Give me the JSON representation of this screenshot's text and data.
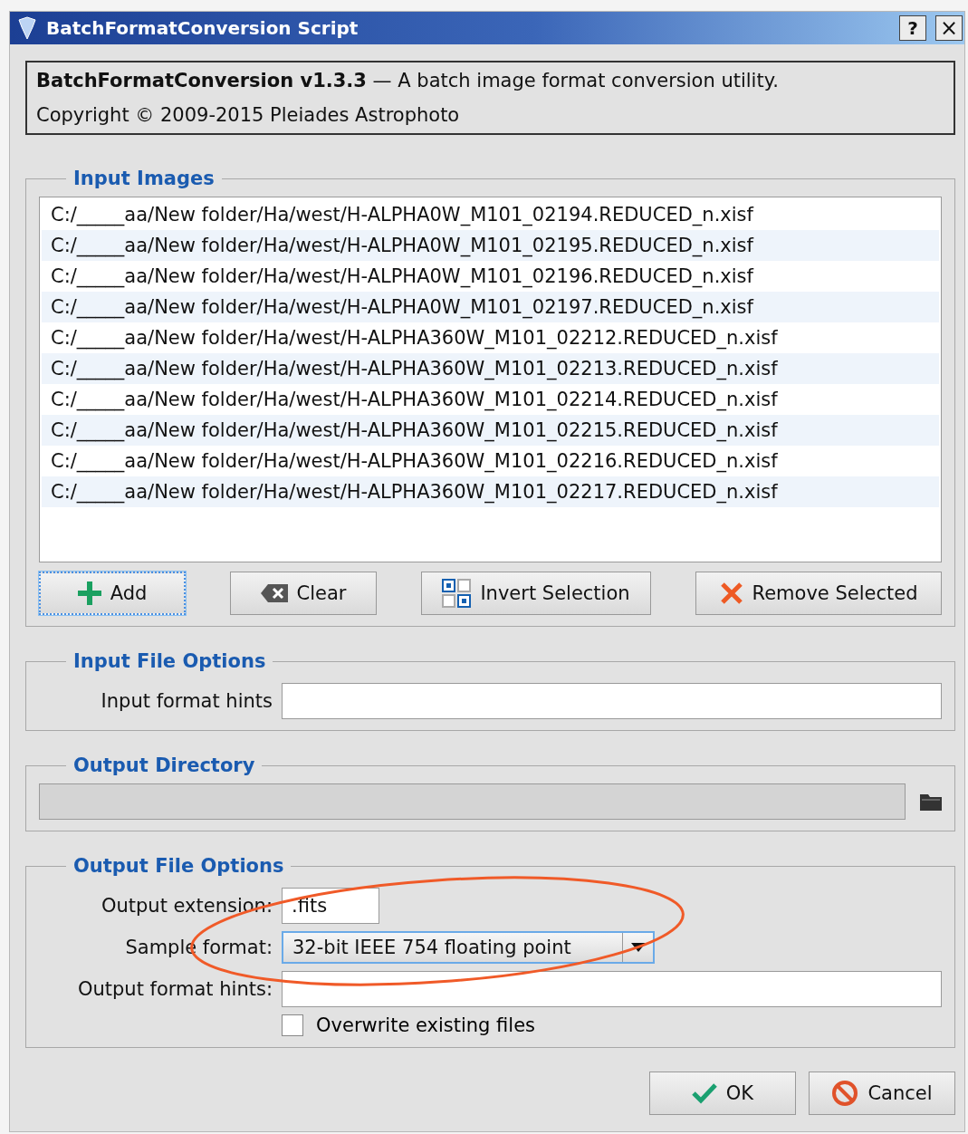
{
  "window": {
    "title": "BatchFormatConversion Script",
    "title_buttons": [
      {
        "kind": "help",
        "label": "?"
      },
      {
        "kind": "close",
        "label": "×"
      }
    ]
  },
  "header": {
    "line": "**BatchFormatConversion v1.3.3** — A batch image format conversion utility.",
    "copyright": "Copyright © 2009-2015 Pleiades Astrophoto"
  },
  "input_images": {
    "title": "Input Images",
    "files": [
      "C:/_____aa/New folder/Ha/west/H-ALPHA0W_M101_02194.REDUCED_n.xisf",
      "C:/_____aa/New folder/Ha/west/H-ALPHA0W_M101_02195.REDUCED_n.xisf",
      "C:/_____aa/New folder/Ha/west/H-ALPHA0W_M101_02196.REDUCED_n.xisf",
      "C:/_____aa/New folder/Ha/west/H-ALPHA0W_M101_02197.REDUCED_n.xisf",
      "C:/_____aa/New folder/Ha/west/H-ALPHA360W_M101_02212.REDUCED_n.xisf",
      "C:/_____aa/New folder/Ha/west/H-ALPHA360W_M101_02213.REDUCED_n.xisf",
      "C:/_____aa/New folder/Ha/west/H-ALPHA360W_M101_02214.REDUCED_n.xisf",
      "C:/_____aa/New folder/Ha/west/H-ALPHA360W_M101_02215.REDUCED_n.xisf",
      "C:/_____aa/New folder/Ha/west/H-ALPHA360W_M101_02216.REDUCED_n.xisf",
      "C:/_____aa/New folder/Ha/west/H-ALPHA360W_M101_02217.REDUCED_n.xisf"
    ],
    "buttons": [
      {
        "kind": "add",
        "label": "Add",
        "focused": true
      },
      {
        "kind": "clear",
        "label": "Clear",
        "focused": false
      },
      {
        "kind": "invert",
        "label": "Invert Selection",
        "focused": false
      },
      {
        "kind": "remove",
        "label": "Remove Selected",
        "focused": false
      }
    ]
  },
  "input_file_options": {
    "title": "Input File Options",
    "hints_label": "Input format hints"
  },
  "output_directory": {
    "title": "Output Directory",
    "disabled": true
  },
  "output_file_options": {
    "title": "Output File Options",
    "extension": {
      "label": "Output extension:",
      "value": ".fits"
    },
    "sample_format": {
      "label": "Sample format:",
      "value": "32-bit IEEE 754 floating point",
      "focused": true
    },
    "hints": {
      "label": "Output format hints:"
    },
    "overwrite": {
      "label": "Overwrite existing files",
      "checked": false
    },
    "annotations": [
      {
        "kind": "ellipse"
      }
    ]
  },
  "dialog_buttons": [
    {
      "kind": "ok",
      "label": "OK"
    },
    {
      "kind": "cancel",
      "label": "Cancel"
    }
  ]
}
